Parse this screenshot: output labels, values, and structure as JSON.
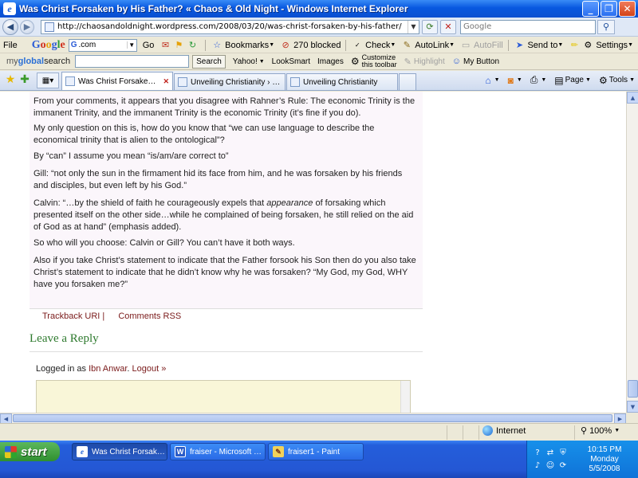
{
  "window": {
    "title": "Was Christ Forsaken by His Father? « Chaos & Old Night - Windows Internet Explorer",
    "app_icon": "e"
  },
  "address": {
    "url": "http://chaosandoldnight.wordpress.com/2008/03/20/was-christ-forsaken-by-his-father/",
    "search_placeholder": "Google"
  },
  "google_toolbar": {
    "file_menu": "File",
    "search_engine": ".com",
    "go": "Go",
    "bookmarks": "Bookmarks",
    "blocked": "270 blocked",
    "check": "Check",
    "autolink": "AutoLink",
    "autofill": "AutoFill",
    "send_to": "Send to",
    "settings": "Settings"
  },
  "mgs_toolbar": {
    "logo_my": "my",
    "logo_global": "global",
    "logo_search": "search",
    "search_button": "Search",
    "yahoo": "Yahoo!",
    "looksmart": "LookSmart",
    "images": "Images",
    "customize_line1": "Customize",
    "customize_line2": "this toolbar",
    "highlight": "Highlight",
    "my_button": "My Button"
  },
  "tabs": [
    {
      "label": "Was Christ Forsaken by ..."
    },
    {
      "label": "Unveiling Christianity › Edit ..."
    },
    {
      "label": "Unveiling Christianity"
    }
  ],
  "commands": {
    "page": "Page",
    "tools": "Tools"
  },
  "comment": {
    "p1": "From your comments, it appears that you disagree with Rahner’s Rule: The economic Trinity is the immanent Trinity, and the immanent Trinity is the economic Trinity (it’s fine if you do).",
    "p2": "My only question on this is, how do you know that “we can use language to describe the economical trinity that is alien to the ontological”?",
    "p3": "By “can” I assume you mean “is/am/are correct to”",
    "p4": "Gill: “not only the sun in the firmament hid its face from him, and he was forsaken by his friends and disciples, but even left by his God.”",
    "p5_a": "Calvin: “…by the shield of faith he courageously expels that ",
    "p5_em": "appearance",
    "p5_b": " of forsaking which presented itself on the other side…while he complained of being forsaken, he still relied on the aid of God as at hand” (emphasis added).",
    "p6": "So who will you choose: Calvin or Gill? You can’t have it both ways.",
    "p7": "Also if you take Christ’s statement to indicate that the Father forsook his Son then do you also take Christ’s statement to indicate that he didn’t know why he was forsaken? “My God, my God, WHY have you forsaken me?”"
  },
  "footer_links": {
    "trackback": "Trackback URI |",
    "comments_rss": "Comments RSS"
  },
  "reply": {
    "heading": "Leave a Reply",
    "logged_prefix": "Logged in as ",
    "user": "Ibn Anwar",
    "logout": "Logout »"
  },
  "status": {
    "zone": "Internet",
    "zoom": "100%"
  },
  "taskbar": {
    "start": "start",
    "tasks": [
      {
        "label": "Was Christ Forsaken ..."
      },
      {
        "label": "fraiser - Microsoft Word"
      },
      {
        "label": "fraiser1 - Paint"
      }
    ],
    "time": "10:15 PM",
    "day": "Monday",
    "date": "5/5/2008"
  }
}
